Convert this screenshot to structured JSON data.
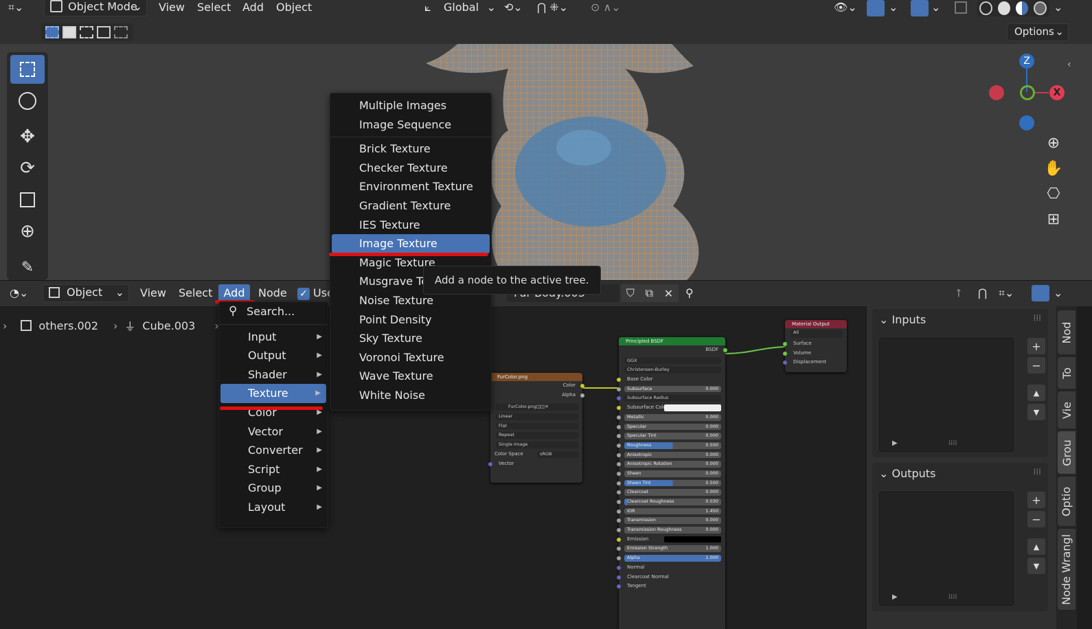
{
  "viewport": {
    "mode_label": "Object Mode",
    "menus": [
      "View",
      "Select",
      "Add",
      "Object"
    ],
    "transform_orientation": "Global",
    "options_label": "Options",
    "gizmo": {
      "z": "Z",
      "x": "X"
    }
  },
  "node_editor": {
    "editor_type_label": "Object",
    "menus": [
      "View",
      "Select",
      "Add",
      "Node"
    ],
    "use_nodes_label": "Use",
    "material_name": "Fur Body.003",
    "breadcrumb": [
      "others.002",
      "Cube.003"
    ]
  },
  "add_menu": {
    "search_label": "Search...",
    "items": [
      "Input",
      "Output",
      "Shader",
      "Texture",
      "Color",
      "Vector",
      "Converter",
      "Script",
      "Group",
      "Layout"
    ],
    "highlighted": "Texture"
  },
  "texture_submenu": {
    "group1": [
      "Multiple Images",
      "Image Sequence"
    ],
    "group2": [
      "Brick Texture",
      "Checker Texture",
      "Environment Texture",
      "Gradient Texture",
      "IES Texture",
      "Image Texture",
      "Magic Texture",
      "Musgrave Texture",
      "Noise Texture",
      "Point Density",
      "Sky Texture",
      "Voronoi Texture",
      "Wave Texture",
      "White Noise"
    ],
    "highlighted": "Image Texture",
    "musgrave_visible": "Musgrave Te"
  },
  "tooltip": "Add a node to the active tree.",
  "image_node": {
    "title": "FurColor.png",
    "outputs": [
      "Color",
      "Alpha"
    ],
    "image_name": "FurColor.png",
    "interpolation": "Linear",
    "projection": "Flat",
    "extension": "Repeat",
    "source": "Single Image",
    "color_space_label": "Color Space",
    "color_space": "sRGB",
    "input": "Vector"
  },
  "bsdf_node": {
    "title": "Principled BSDF",
    "output": "BSDF",
    "distribution": "GGX",
    "subsurface_method": "Christensen-Burley",
    "base_color_label": "Base Color",
    "fields": [
      {
        "label": "Subsurface",
        "value": "0.000",
        "fill": 0
      },
      {
        "label": "Subsurface Radius",
        "value": "",
        "dropdown": true
      },
      {
        "label": "Subsurface Color",
        "value": "",
        "color": true
      },
      {
        "label": "Metallic",
        "value": "0.000",
        "fill": 0
      },
      {
        "label": "Specular",
        "value": "0.000",
        "fill": 0
      },
      {
        "label": "Specular Tint",
        "value": "0.000",
        "fill": 0
      },
      {
        "label": "Roughness",
        "value": "0.500",
        "fill": 0.5
      },
      {
        "label": "Anisotropic",
        "value": "0.000",
        "fill": 0
      },
      {
        "label": "Anisotropic Rotation",
        "value": "0.000",
        "fill": 0
      },
      {
        "label": "Sheen",
        "value": "0.000",
        "fill": 0
      },
      {
        "label": "Sheen Tint",
        "value": "0.500",
        "fill": 0.5
      },
      {
        "label": "Clearcoat",
        "value": "0.000",
        "fill": 0
      },
      {
        "label": "Clearcoat Roughness",
        "value": "0.030",
        "fill": 0.03
      },
      {
        "label": "IOR",
        "value": "1.450",
        "fill": 0
      },
      {
        "label": "Transmission",
        "value": "0.000",
        "fill": 0
      },
      {
        "label": "Transmission Roughness",
        "value": "0.000",
        "fill": 0
      },
      {
        "label": "Emission",
        "value": "",
        "black": true
      },
      {
        "label": "Emission Strength",
        "value": "1.000",
        "fill": 0
      },
      {
        "label": "Alpha",
        "value": "1.000",
        "fill": 1
      }
    ],
    "inputs_tail": [
      "Normal",
      "Clearcoat Normal",
      "Tangent"
    ]
  },
  "output_node": {
    "title": "Material Output",
    "target": "All",
    "inputs": [
      "Surface",
      "Volume",
      "Displacement"
    ]
  },
  "sidebar": {
    "inputs_label": "Inputs",
    "outputs_label": "Outputs",
    "tabs": [
      "Nod",
      "To",
      "Vie",
      "Grou",
      "Optio",
      "Node Wrangl"
    ]
  },
  "colors": {
    "accent": "#4772b3",
    "underline": "#e01010",
    "mesh_orange": "#e8923a"
  }
}
